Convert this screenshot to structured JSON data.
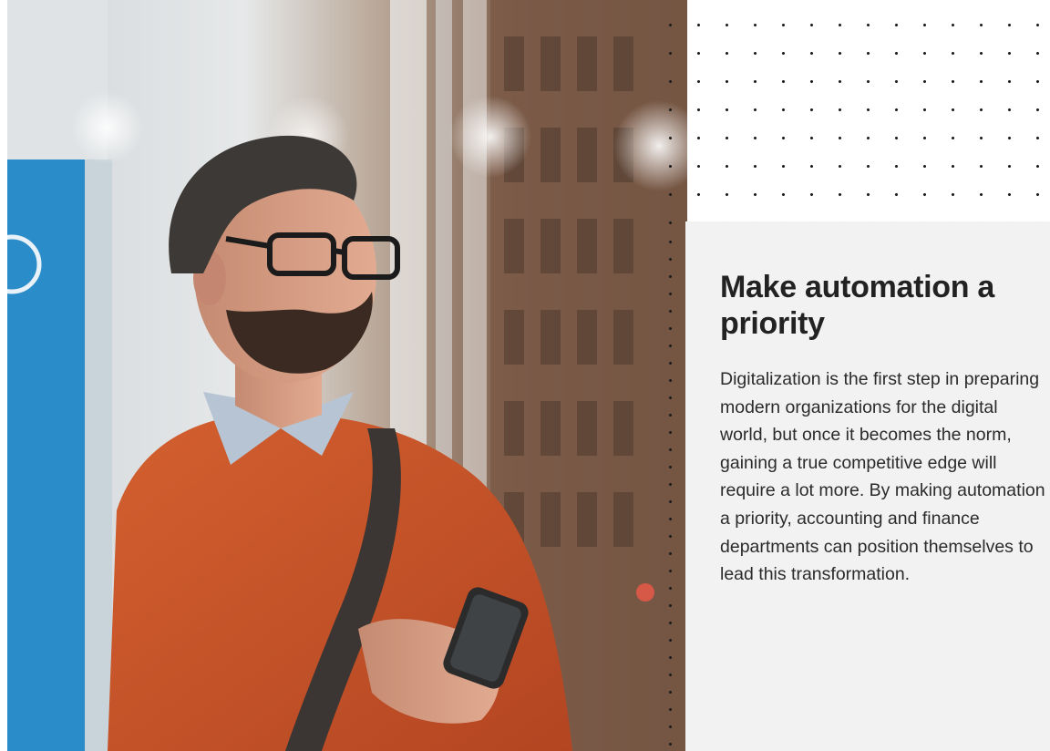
{
  "article": {
    "title": "Make automation a priority",
    "body": "Digitalization is the first step in preparing modern organizations for the digital world, but once it becomes the norm, gaining a true competitive edge will require a lot more. By making automation a priority, accounting and finance departments can position themselves to lead this transformation."
  },
  "colors": {
    "card_background": "#f2f2f2",
    "title_text": "#222222",
    "body_text": "#2b2b2b",
    "dots": "#1d1d1d",
    "sweater": "#c9542c",
    "blue_sign": "#2a8cc9"
  },
  "image": {
    "subject": "man with glasses and beard in orange sweater holding a smartphone on a city street"
  }
}
